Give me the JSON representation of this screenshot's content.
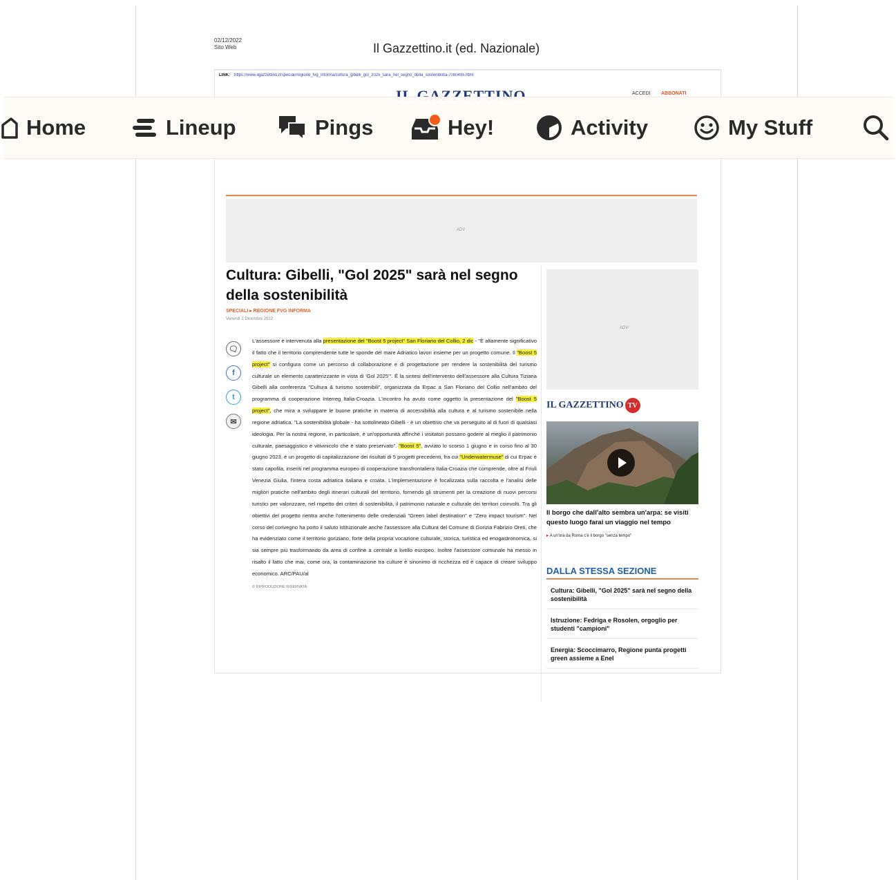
{
  "viewer": {
    "doc_date": "02/12/2022",
    "doc_source_type": "Sito Web",
    "publication": "Il Gazzettino.it (ed. Nazionale)",
    "link_label": "LINK:",
    "link_url": "https://www.ilgazzettino.it/speciali/regione_fvg_informa/cultura_gibelli_gol_2025_sara_nel_segno_della_sostenibilita-7080495.html"
  },
  "article": {
    "masthead": "IL GAZZETTINO",
    "login": "ACCEDI",
    "subscribe": "ABBONATI",
    "ad_label": "ADV",
    "headline": "Cultura: Gibelli, \"Gol 2025\" sarà nel segno della sostenibilità",
    "breadcrumb": "SPECIALI ▸ REGIONE FVG INFORMA",
    "date": "Venerdì 2 Dicembre 2022",
    "body": {
      "p1": "L'assessore è intervenuta alla ",
      "hl1": "presentazione del \"Boost 5 project\" San Floriano del Collio, 2 dic",
      "p2": " - \"È altamente significativo il fatto che il territorio comprendente tutte le sponde del mare Adriatico lavori insieme per un progetto comune. Il ",
      "hl2": "\"Boost 5 project\"",
      "p3": " si configura come un percorso di collaborazione e di progettazione per rendere la sostenibilità del turismo culturale un elemento caratterizzante in vista di 'Gol 2025'\". È la sintesi dell'intervento dell'assessore alla Cultura Tiziana Gibelli alla conferenza \"Cultura & turismo sostenibili\", organizzata da Erpac a San Floriano del Collio nell'ambito del programma di cooperazione Interreg Italia-Croazia. L'incontro ha avuto come oggetto la presentazione del ",
      "hl3": "\"Boost 5 project\"",
      "p4": ", che mira a sviluppare le buone pratiche in materia di accessibilità alla cultura e al turismo sostenibile nella regione adriatica. \"La sostenibilità globale - ha sottolineato Gibelli - è un obiettivo che va perseguito al di fuori di qualsiasi ideologia. Per la nostra regione, in particolare, è un'opportunità affinché i visitatori possano godere al meglio il patrimonio culturale, paesaggistico e vitivinicolo che è stato preservato\". ",
      "hl4": "\"Boost 5\"",
      "p5": ", avviato lo scorso 1 giugno e in corso fino al 30 giugno 2023, è un progetto di capitalizzazione dei risultati di 5 progetti precedenti, fra cui ",
      "hl5": "\"Underwatermuse\"",
      "p6": " di cui Erpac è stato capofila, inseriti nel programma europeo di cooperazione transfrontaliera Italia-Croazia che comprende, oltre al Friuli Venezia Giulia, l'intera costa adriatica italiana e croata. L'implementazione è focalizzata sulla raccolta e l'analisi delle migliori pratiche nell'ambito degli itinerari culturali del territorio, fornendo gli strumenti per la creazione di nuovi percorsi turistici per valorizzare, nel rispetto dei criteri di sostenibilità, il patrimonio naturale e culturale dei territori coinvolti. Tra gli obiettivi del progetto rientra anche l'ottenimento delle credenziali \"Green label destination\" e \"Zero impact tourism\". Nel corso del convegno ha porto il saluto istituzionale anche l'assessore alla Cultura del Comune di Gorizia Fabrizio Oreti, che ha evidenziato come il territorio goriziano, forte della propria vocazione culturale, storica, turistica ed enogastronomica, si sia sempre più trasformando da area di confine a centrale a livello europeo. Inoltre l'assessore comunale ha messo in risalto il fatto che mai, come ora, la contaminazione tra culture è sinonimo di ricchezza ed è capace di creare sviluppo economico. ARC/PAU/al",
      "copyright": "© RIPRODUZIONE RISERVATA"
    },
    "sidebar": {
      "ad_label": "ADV",
      "tv_brand": "IL GAZZETTINO",
      "tv_badge": "TV",
      "video_caption": "Il borgo che dall'alto sembra un'arpa: se visiti questo luogo farai un viaggio nel tempo",
      "video_sub": "A un'ora da Roma c'è il borgo \"senza tempo\"",
      "section_title": "DALLA STESSA SEZIONE",
      "related": [
        "Cultura: Gibelli, \"Gol 2025\" sarà nel segno della sostenibilità",
        "Istruzione: Fedriga e Rosolen, orgoglio per studenti \"campioni\"",
        "Energia: Scoccimarro, Regione punta progetti green assieme a Enel"
      ]
    }
  },
  "navbar": {
    "items": [
      {
        "label": "Home",
        "icon": "home-icon"
      },
      {
        "label": "Lineup",
        "icon": "lineup-icon"
      },
      {
        "label": "Pings",
        "icon": "chat-bubbles-icon"
      },
      {
        "label": "Hey!",
        "icon": "inbox-icon"
      },
      {
        "label": "Activity",
        "icon": "half-circle-icon"
      },
      {
        "label": "My Stuff",
        "icon": "smiley-icon"
      }
    ],
    "search_icon": "search-icon",
    "accent_color": "#f25c19"
  }
}
